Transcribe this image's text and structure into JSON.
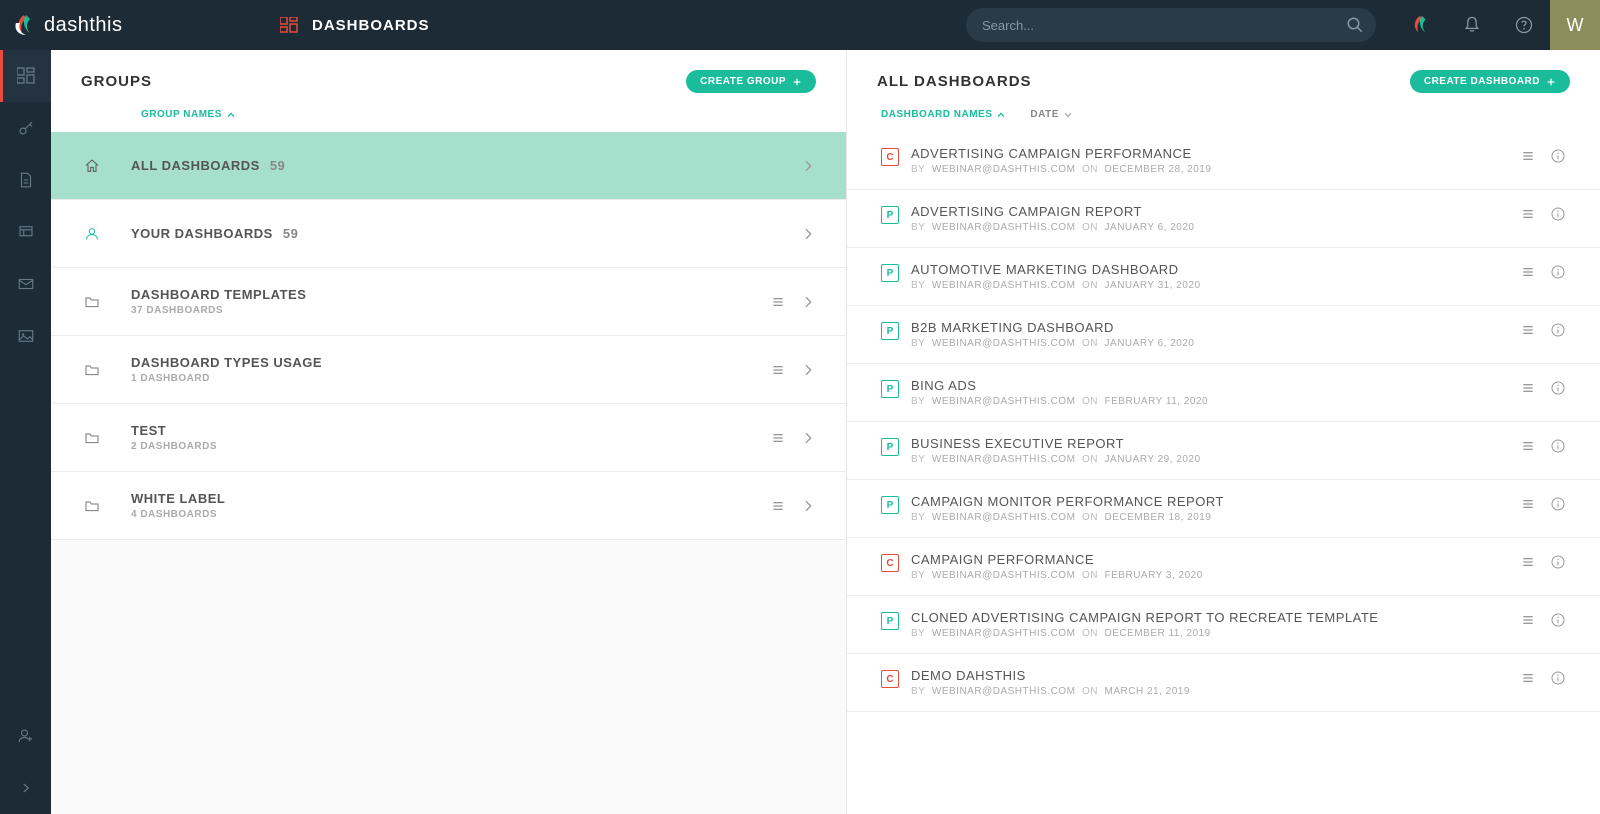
{
  "brand": "dashthis",
  "page_title": "DASHBOARDS",
  "search": {
    "placeholder": "Search..."
  },
  "avatar": "W",
  "left": {
    "title": "GROUPS",
    "create": "CREATE GROUP",
    "sort": {
      "group_names": "GROUP NAMES"
    },
    "rows": [
      {
        "icon": "home",
        "title": "ALL DASHBOARDS",
        "count": "59",
        "sub": "",
        "selected": true,
        "has_menu": false
      },
      {
        "icon": "user",
        "title": "YOUR DASHBOARDS",
        "count": "59",
        "sub": "",
        "selected": false,
        "has_menu": false,
        "your": true
      },
      {
        "icon": "folder",
        "title": "DASHBOARD TEMPLATES",
        "count": "",
        "sub": "37 DASHBOARDS",
        "selected": false,
        "has_menu": true
      },
      {
        "icon": "folder",
        "title": "DASHBOARD TYPES USAGE",
        "count": "",
        "sub": "1 DASHBOARD",
        "selected": false,
        "has_menu": true
      },
      {
        "icon": "folder",
        "title": "TEST",
        "count": "",
        "sub": "2 DASHBOARDS",
        "selected": false,
        "has_menu": true
      },
      {
        "icon": "folder",
        "title": "WHITE LABEL",
        "count": "",
        "sub": "4 DASHBOARDS",
        "selected": false,
        "has_menu": true
      }
    ]
  },
  "right": {
    "title": "ALL DASHBOARDS",
    "create": "CREATE DASHBOARD",
    "sort": {
      "names": "DASHBOARD NAMES",
      "date": "DATE"
    },
    "meta_labels": {
      "by": "BY",
      "on": "ON"
    },
    "rows": [
      {
        "badge": "C",
        "title": "ADVERTISING CAMPAIGN PERFORMANCE",
        "by": "WEBINAR@DASHTHIS.COM",
        "date": "DECEMBER 28, 2019"
      },
      {
        "badge": "P",
        "title": "ADVERTISING CAMPAIGN REPORT",
        "by": "WEBINAR@DASHTHIS.COM",
        "date": "JANUARY 6, 2020"
      },
      {
        "badge": "P",
        "title": "AUTOMOTIVE MARKETING DASHBOARD",
        "by": "WEBINAR@DASHTHIS.COM",
        "date": "JANUARY 31, 2020"
      },
      {
        "badge": "P",
        "title": "B2B MARKETING DASHBOARD",
        "by": "WEBINAR@DASHTHIS.COM",
        "date": "JANUARY 6, 2020"
      },
      {
        "badge": "P",
        "title": "BING ADS",
        "by": "WEBINAR@DASHTHIS.COM",
        "date": "FEBRUARY 11, 2020"
      },
      {
        "badge": "P",
        "title": "BUSINESS EXECUTIVE REPORT",
        "by": "WEBINAR@DASHTHIS.COM",
        "date": "JANUARY 29, 2020"
      },
      {
        "badge": "P",
        "title": "CAMPAIGN MONITOR PERFORMANCE REPORT",
        "by": "WEBINAR@DASHTHIS.COM",
        "date": "DECEMBER 18, 2019"
      },
      {
        "badge": "C",
        "title": "CAMPAIGN PERFORMANCE",
        "by": "WEBINAR@DASHTHIS.COM",
        "date": "FEBRUARY 3, 2020"
      },
      {
        "badge": "P",
        "title": "CLONED ADVERTISING CAMPAIGN REPORT TO RECREATE TEMPLATE",
        "by": "WEBINAR@DASHTHIS.COM",
        "date": "DECEMBER 11, 2019"
      },
      {
        "badge": "C",
        "title": "DEMO DAHSTHIS",
        "by": "WEBINAR@DASHTHIS.COM",
        "date": "MARCH 21, 2019"
      }
    ]
  }
}
